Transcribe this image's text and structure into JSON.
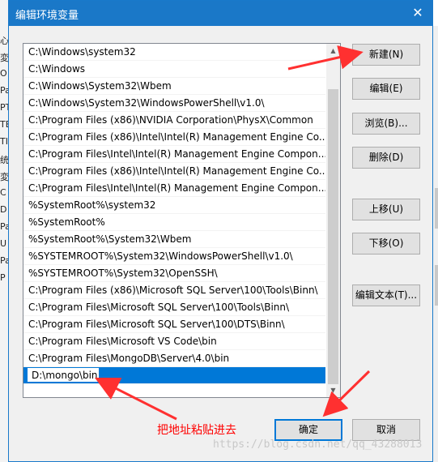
{
  "background": {
    "left_fragments": [
      "心",
      "変",
      "O",
      "Pa",
      "PT",
      "TE",
      "TI",
      "统",
      "変",
      "C",
      "D",
      "Pa",
      "U",
      "Pa",
      "P"
    ]
  },
  "dialog": {
    "title": "编辑环境变量",
    "close_glyph": "✕"
  },
  "path_list": {
    "items": [
      "C:\\Windows\\system32",
      "C:\\Windows",
      "C:\\Windows\\System32\\Wbem",
      "C:\\Windows\\System32\\WindowsPowerShell\\v1.0\\",
      "C:\\Program Files (x86)\\NVIDIA Corporation\\PhysX\\Common",
      "C:\\Program Files (x86)\\Intel\\Intel(R) Management Engine Co...",
      "C:\\Program Files\\Intel\\Intel(R) Management Engine Compon...",
      "C:\\Program Files (x86)\\Intel\\Intel(R) Management Engine Co...",
      "C:\\Program Files\\Intel\\Intel(R) Management Engine Compon...",
      "%SystemRoot%\\system32",
      "%SystemRoot%",
      "%SystemRoot%\\System32\\Wbem",
      "%SYSTEMROOT%\\System32\\WindowsPowerShell\\v1.0\\",
      "%SYSTEMROOT%\\System32\\OpenSSH\\",
      "C:\\Program Files (x86)\\Microsoft SQL Server\\100\\Tools\\Binn\\",
      "C:\\Program Files\\Microsoft SQL Server\\100\\Tools\\Binn\\",
      "C:\\Program Files\\Microsoft SQL Server\\100\\DTS\\Binn\\",
      "C:\\Program Files\\Microsoft VS Code\\bin",
      "C:\\Program Files\\MongoDB\\Server\\4.0\\bin"
    ],
    "editing_value": "D:\\mongo\\bin"
  },
  "buttons": {
    "new": "新建(N)",
    "edit": "编辑(E)",
    "browse": "浏览(B)...",
    "delete": "删除(D)",
    "move_up": "上移(U)",
    "move_down": "下移(O)",
    "edit_text": "编辑文本(T)...",
    "ok": "确定",
    "cancel": "取消"
  },
  "annotation": {
    "text": "把地址粘贴进去",
    "color": "#ff0000"
  },
  "watermark": "https://blog.csdn.net/qq_43288013",
  "colors": {
    "title_bar": "#1a78c8",
    "selection": "#0078d7"
  }
}
